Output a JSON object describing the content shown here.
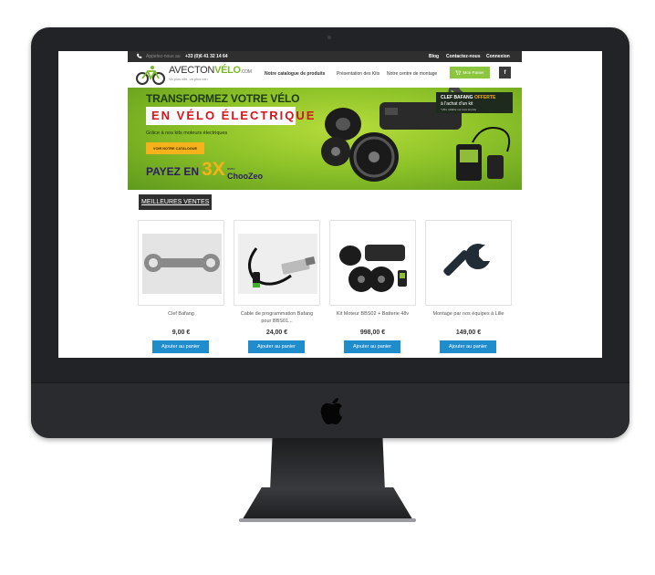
{
  "topbar": {
    "call_label": "Appelez-nous au",
    "phone": "+33 (0)6 41 32 14 64",
    "links": [
      "Blog",
      "Contactez-nous",
      "Connexion"
    ]
  },
  "header": {
    "brand_part1": "AVECTON",
    "brand_part2": "VÉLO",
    "brand_suffix": ".COM",
    "tagline": "Va plus vite, va plus loin",
    "nav": [
      "Notre catalogue de produits",
      "Présentation des Kits",
      "Notre centre de montage"
    ],
    "cart_label": "Mon Panier",
    "facebook_label": "f"
  },
  "banner": {
    "title": "TRANSFORMEZ VOTRE VÉLO",
    "highlight": "EN VÉLO ÉLECTRIQUE",
    "subtitle": "Grâce à nos kits moteurs électriques",
    "button": "VOIR NOTRE CATALOGUE",
    "payez": "PAYEZ EN",
    "three_x": "3X",
    "avec": "avec",
    "chooze": "ChooZeo",
    "offer_line1_a": "CLEF BAFANG ",
    "offer_line1_b": "OFFERTE",
    "offer_line2": "à l'achat d'un kit",
    "offer_line3": "*offre valable sur tous les kits"
  },
  "best_sellers": {
    "title": "MEILLEURES VENTES",
    "add_label": "Ajouter au panier",
    "products": [
      {
        "name": "Clef Bafang",
        "price": "9,00 €",
        "icon": "wrench-key-image"
      },
      {
        "name": "Cable de programmation Bafang pour BBS01...",
        "price": "24,00 €",
        "icon": "usb-cable-image"
      },
      {
        "name": "Kit Moteur BBS02 + Batterie 48v",
        "price": "998,00 €",
        "icon": "motor-kit-image"
      },
      {
        "name": "Montage par nos équipes à Lille",
        "price": "149,00 €",
        "icon": "wrench-icon"
      }
    ]
  },
  "colors": {
    "accent_green": "#8cc63f",
    "button_blue": "#1f8ccc",
    "banner_red": "#d4151c",
    "banner_orange": "#f6b21b"
  }
}
